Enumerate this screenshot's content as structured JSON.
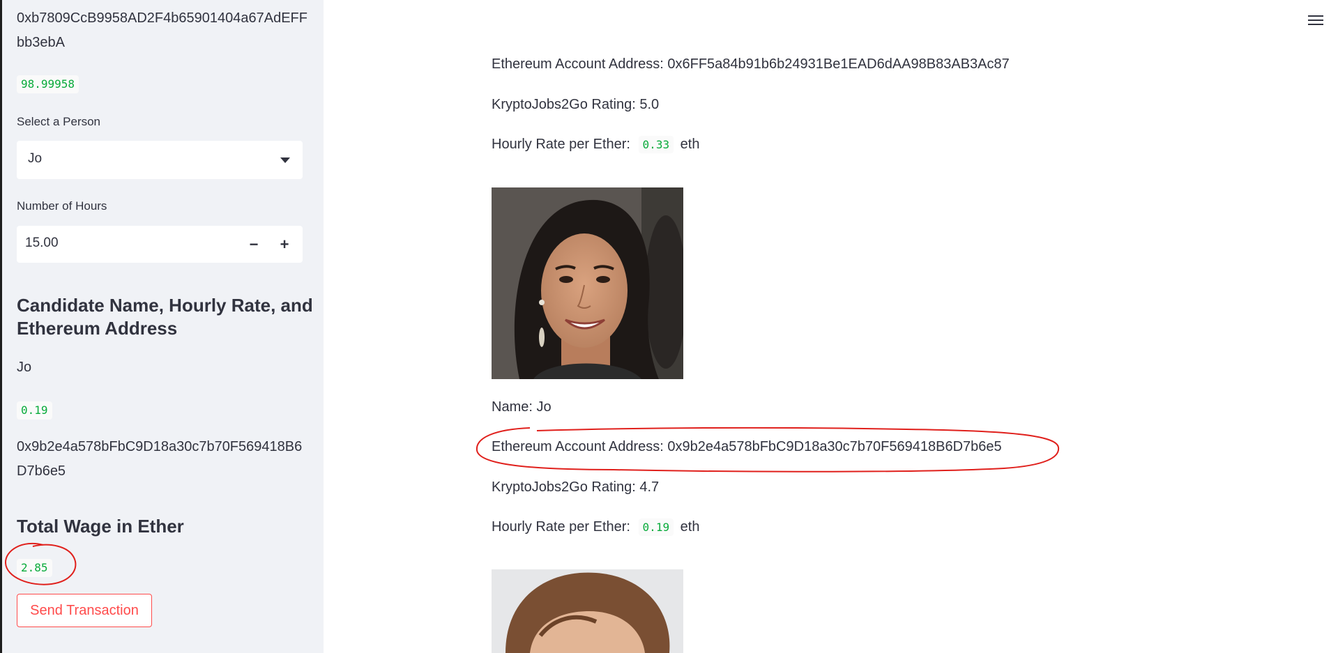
{
  "sidebar": {
    "account_address_line1": "0xb7809CcB9958AD2F4b65901404a67AdEFF",
    "account_address_line2": "bb3ebA",
    "balance": "98.99958",
    "select_label": "Select a Person",
    "selected_person": "Jo",
    "hours_label": "Number of Hours",
    "hours_value": "15.00",
    "minus_label": "−",
    "plus_label": "+",
    "candidate_heading_line1": "Candidate Name, Hourly Rate, and",
    "candidate_heading_line2": "Ethereum Address",
    "candidate_name": "Jo",
    "candidate_rate": "0.19",
    "candidate_address_line1": "0x9b2e4a578bFbC9D18a30c7b70F569418B6",
    "candidate_address_line2": "D7b6e5",
    "total_wage_heading": "Total Wage in Ether",
    "total_wage": "2.85",
    "send_button": "Send Transaction"
  },
  "main": {
    "menu_icon": "hamburger-icon",
    "candidate_prev": {
      "address": "Ethereum Account Address: 0x6FF5a84b91b6b24931Be1EAD6dAA98B83AB3Ac87",
      "rating": "KryptoJobs2Go Rating: 5.0",
      "rate_prefix": "Hourly Rate per Ether:",
      "rate_value": "0.33",
      "rate_suffix": "eth"
    },
    "candidate_jo": {
      "name": "Name: Jo",
      "address": "Ethereum Account Address: 0x9b2e4a578bFbC9D18a30c7b70F569418B6D7b6e5",
      "rating": "KryptoJobs2Go Rating: 4.7",
      "rate_prefix": "Hourly Rate per Ether:",
      "rate_value": "0.19",
      "rate_suffix": "eth"
    }
  },
  "colors": {
    "sidebar_bg": "#f0f2f6",
    "code_green": "#09ab3b",
    "button_red": "#ff4b4b",
    "annotation_red": "#e0201c"
  }
}
